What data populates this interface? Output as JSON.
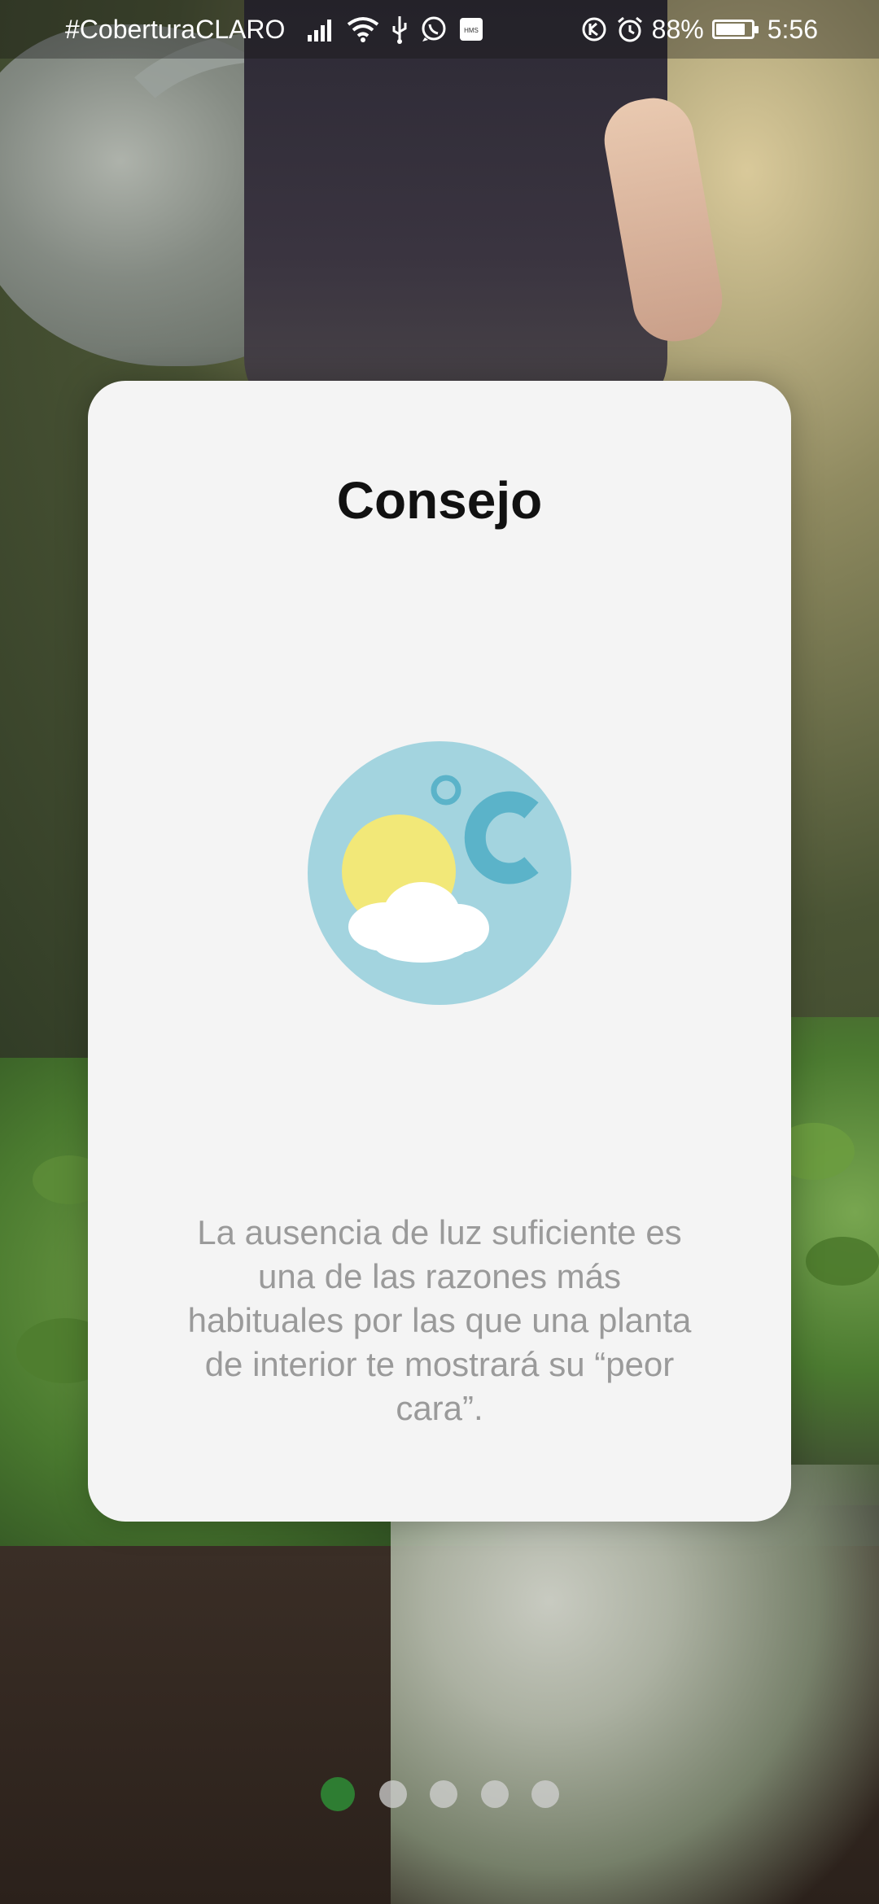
{
  "status_bar": {
    "carrier": "#CoberturaCLARO",
    "battery_percent": "88%",
    "time": "5:56",
    "battery_level": 0.88,
    "icons_left": [
      "signal-icon",
      "wifi-icon",
      "usb-icon",
      "whatsapp-icon",
      "hms-icon"
    ],
    "icons_right": [
      "data-saver-icon",
      "alarm-icon",
      "battery-icon"
    ]
  },
  "card": {
    "title": "Consejo",
    "illustration": "temperature-weather-icon",
    "text": "La ausencia de luz suficiente es una de las razones más habituales por las que una planta de interior te mostrará su “peor cara”."
  },
  "pager": {
    "total": 5,
    "active_index": 0,
    "active_color": "#2e7d32"
  },
  "colors": {
    "card_bg": "#f4f4f4",
    "title": "#111111",
    "body_text": "#9a9a9a",
    "icon_circle": "#a3d4df",
    "sun": "#f2e878",
    "celsius": "#5bb3c9"
  }
}
